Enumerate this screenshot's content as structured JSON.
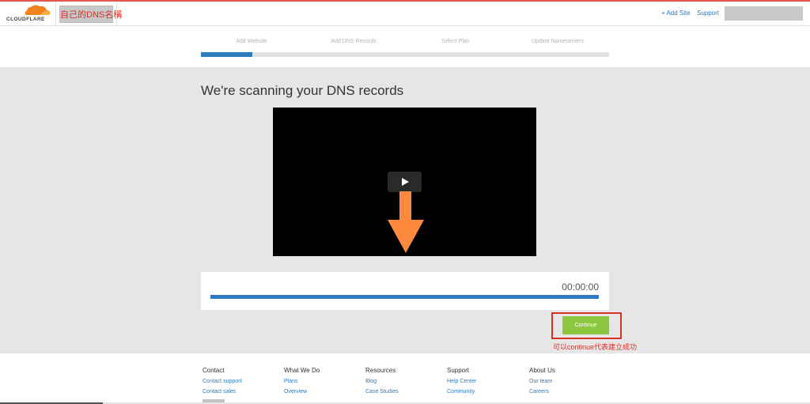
{
  "header": {
    "logo_text": "CLOUDFLARE",
    "site_name": "自己的DNS名稱",
    "add_site_label": "+ Add Site",
    "support_label": "Support"
  },
  "steps": {
    "items": [
      "Add Website",
      "Add DNS Records",
      "Select Plan",
      "Update Nameservers"
    ],
    "progress_fraction": 0.125
  },
  "main": {
    "title": "We're scanning your DNS records",
    "timer": "00:00:00",
    "timer_progress_fraction": 1.0,
    "continue_label": "Continue",
    "annotation": "可以continue代表建立成功"
  },
  "footer": {
    "columns": [
      {
        "heading": "Contact",
        "links": [
          "Contact support",
          "Contact sales"
        ]
      },
      {
        "heading": "What We Do",
        "links": [
          "Plans",
          "Overview"
        ]
      },
      {
        "heading": "Resources",
        "links": [
          "Blog",
          "Case Studies"
        ]
      },
      {
        "heading": "Support",
        "links": [
          "Help Center",
          "Community"
        ]
      },
      {
        "heading": "About Us",
        "links": [
          "Our team",
          "Careers"
        ]
      }
    ]
  },
  "colors": {
    "brand_orange": "#f48120",
    "link_blue": "#2f7bbf",
    "continue_green": "#8dc63f",
    "annotation_red": "#d93025",
    "arrow_orange": "#ff8a3d"
  },
  "icons": {
    "logo": "cloudflare-cloud-logo",
    "play": "play-icon",
    "arrow": "arrow-down-icon"
  }
}
